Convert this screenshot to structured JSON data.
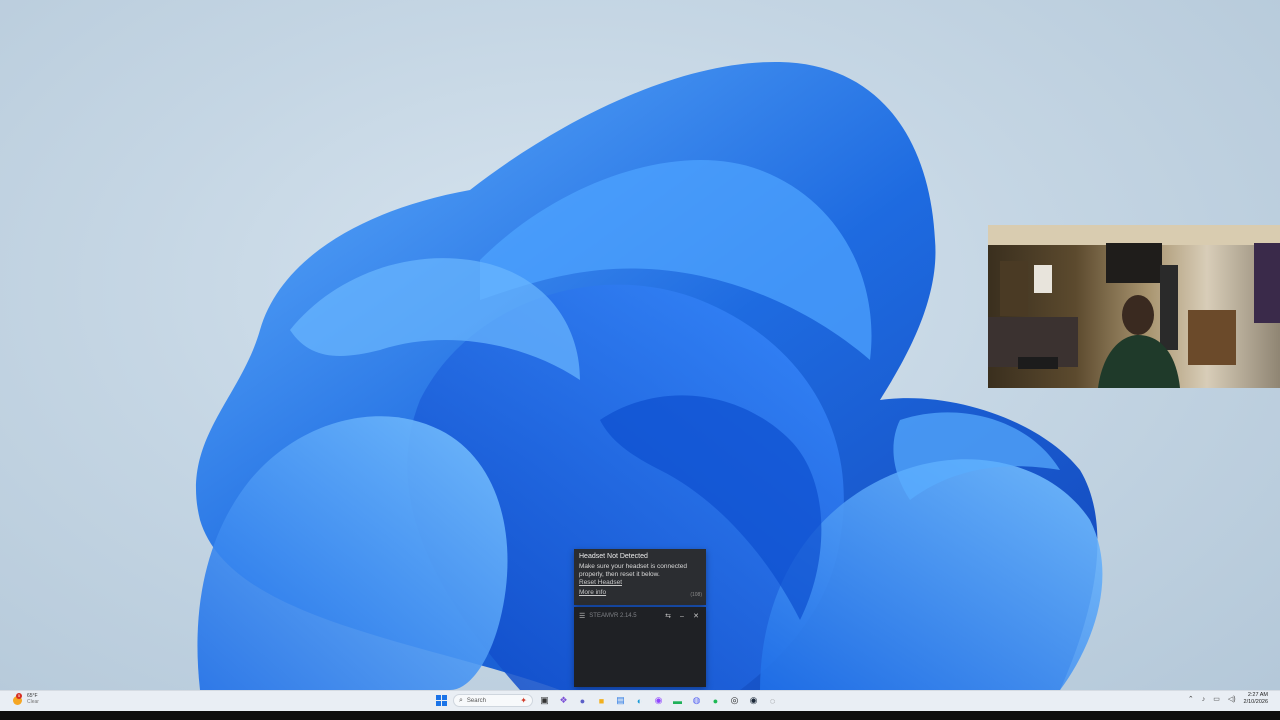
{
  "popup": {
    "title": "Headset Not Detected",
    "message": "Make sure your headset is connected properly, then reset it below.",
    "reset_link": "Reset Headset",
    "more_info_link": "More info",
    "code": "(108)"
  },
  "steamvr": {
    "title": "STEAMVR 2.14.5"
  },
  "taskbar": {
    "weather_temp": "65°F",
    "weather_condition": "Clear",
    "weather_badge": "5",
    "search_placeholder": "Search",
    "time": "2:27 AM",
    "date": "2/10/2026"
  },
  "colors": {
    "accent": "#1a73e8",
    "popup_bg": "#2b2d31",
    "taskbar_bg": "#e9eef4"
  }
}
